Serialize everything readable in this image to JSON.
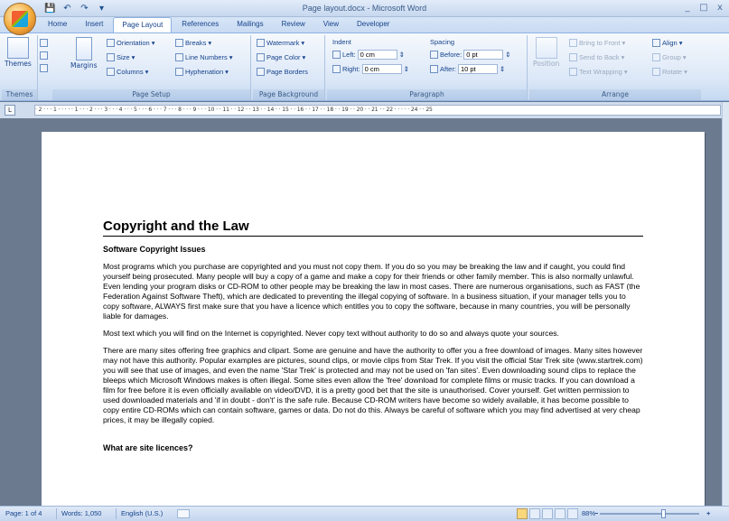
{
  "window": {
    "title": "Page layout.docx - Microsoft Word",
    "minimize": "_",
    "maximize": "□",
    "close": "x"
  },
  "quick_access": {
    "save": "💾",
    "undo": "↶",
    "redo": "↷",
    "customize": "▾"
  },
  "tabs": [
    "Home",
    "Insert",
    "Page Layout",
    "References",
    "Mailings",
    "Review",
    "View",
    "Developer"
  ],
  "active_tab": "Page Layout",
  "ribbon": {
    "themes": {
      "label": "Themes",
      "big_button": "Themes"
    },
    "page_setup": {
      "label": "Page Setup",
      "margins": "Margins",
      "orientation": "Orientation",
      "size": "Size",
      "columns": "Columns",
      "breaks": "Breaks",
      "line_numbers": "Line Numbers",
      "hyphenation": "Hyphenation"
    },
    "page_background": {
      "label": "Page Background",
      "watermark": "Watermark",
      "page_color": "Page Color",
      "page_borders": "Page Borders"
    },
    "paragraph": {
      "label": "Paragraph",
      "indent_title": "Indent",
      "left_label": "Left:",
      "left_value": "0 cm",
      "right_label": "Right:",
      "right_value": "0 cm",
      "spacing_title": "Spacing",
      "before_label": "Before:",
      "before_value": "0 pt",
      "after_label": "After:",
      "after_value": "10 pt"
    },
    "arrange": {
      "label": "Arrange",
      "position": "Position",
      "bring_to_front": "Bring to Front",
      "send_to_back": "Send to Back",
      "text_wrapping": "Text Wrapping",
      "align": "Align",
      "group": "Group",
      "rotate": "Rotate"
    }
  },
  "ruler": {
    "text": "· 2 · · · 1 · · · · · 1 · · · 2 · · · 3 · · · 4 · · · 5 · · · 6 · · · 7 · · · 8 · · · 9 · · · 10 · · 11 · · 12 · · 13 · · 14 · · 15 · · 16 · · 17 · · 18 · · 19 · · 20 · · 21 · · 22 · · · · · 24 · · 25"
  },
  "document": {
    "title": "Copyright and the Law",
    "heading1": "Software Copyright Issues",
    "paragraphs": [
      "Most programs which you purchase are copyrighted and you must not copy them. If you do so you may be breaking the law and if caught, you could find yourself being prosecuted. Many people will buy a copy of a game and make a copy for their friends or other family member. This is also normally unlawful. Even lending your program disks or CD-ROM to other people may be breaking the law in most cases. There are numerous organisations, such as FAST (the Federation Against Software Theft), which are dedicated to preventing the illegal copying of software. In a business situation, if your manager tells you to copy software, ALWAYS first make sure that you have a licence which entitles you to copy the software, because in many countries, you will be personally liable for damages.",
      "Most text which you will find on the Internet is copyrighted. Never copy text without authority to do so and always quote your sources.",
      "There are many sites offering free graphics and clipart. Some are genuine and have the authority to offer you a free download of images. Many sites however may not have this authority. Popular examples are pictures, sound clips, or movie clips from Star Trek. If you visit the official Star Trek site (www.startrek.com) you will see that use of images, and even the name 'Star Trek' is protected and may not be used on 'fan sites'. Even downloading sound clips to replace the bleeps which Microsoft Windows makes is often illegal. Some sites even allow the 'free' download for complete films or music tracks. If you can download a film for free before it is even officially available on video/DVD, it is a pretty good bet that the site is unauthorised. Cover yourself. Get written permission to used downloaded materials and 'if in doubt - don't' is the safe rule. Because CD-ROM writers have become so widely available, it has become possible to copy entire CD-ROMs which can contain software, games or data. Do not do this. Always be careful of software which you may find advertised at very cheap prices, it may be illegally copied."
    ],
    "heading2": "What are site licences?"
  },
  "status": {
    "page": "Page: 1 of 4",
    "words": "Words: 1,050",
    "language": "English (U.S.)",
    "zoom": "88%",
    "zoom_out": "−",
    "zoom_in": "+"
  }
}
